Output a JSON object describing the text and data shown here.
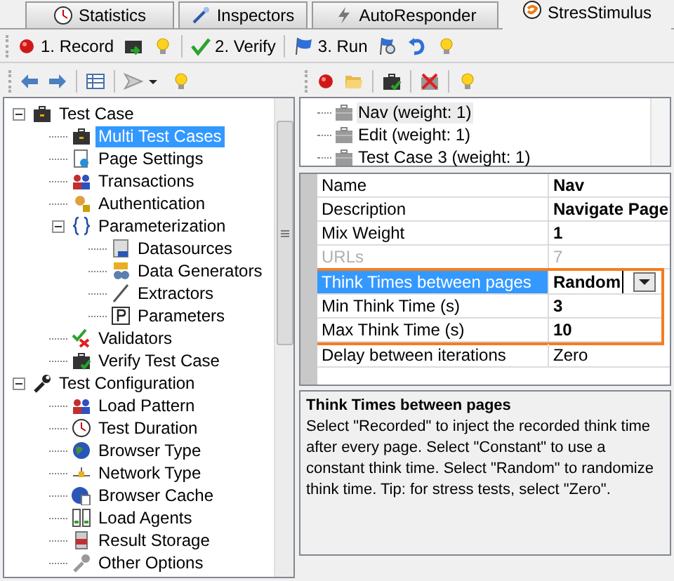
{
  "tabs": [
    {
      "label": "Statistics",
      "selected": false
    },
    {
      "label": "Inspectors",
      "selected": false
    },
    {
      "label": "AutoResponder",
      "selected": false
    },
    {
      "label": "StresStimulus",
      "selected": true
    }
  ],
  "main_toolbar": [
    "1. Record",
    "2. Verify",
    "3. Run"
  ],
  "tree": [
    {
      "label": "Test Case",
      "expanded": true,
      "selected": false,
      "children": [
        {
          "label": "Multi Test Cases",
          "selected": true
        },
        {
          "label": "Page Settings",
          "selected": false
        },
        {
          "label": "Transactions",
          "selected": false
        },
        {
          "label": "Authentication",
          "selected": false
        },
        {
          "label": "Parameterization",
          "expanded": true,
          "selected": false,
          "children": [
            {
              "label": "Datasources",
              "selected": false
            },
            {
              "label": "Data Generators",
              "selected": false
            },
            {
              "label": "Extractors",
              "selected": false
            },
            {
              "label": "Parameters",
              "selected": false
            }
          ]
        },
        {
          "label": "Validators",
          "selected": false
        },
        {
          "label": "Verify Test Case",
          "selected": false
        }
      ]
    },
    {
      "label": "Test Configuration",
      "expanded": true,
      "selected": false,
      "children": [
        {
          "label": "Load Pattern",
          "selected": false
        },
        {
          "label": "Test Duration",
          "selected": false
        },
        {
          "label": "Browser Type",
          "selected": false
        },
        {
          "label": "Network Type",
          "selected": false
        },
        {
          "label": "Browser Cache",
          "selected": false
        },
        {
          "label": "Load Agents",
          "selected": false
        },
        {
          "label": "Result Storage",
          "selected": false
        },
        {
          "label": "Other Options",
          "selected": false
        }
      ]
    }
  ],
  "test_cases": [
    {
      "label": "Nav (weight: 1)",
      "selected": true
    },
    {
      "label": "Edit (weight: 1)",
      "selected": false
    },
    {
      "label": "Test Case 3 (weight: 1)",
      "selected": false
    }
  ],
  "properties": [
    {
      "name": "Name",
      "value": "Nav",
      "modified": true,
      "disabled": false,
      "selected": false,
      "highlighted": false
    },
    {
      "name": "Description",
      "value": "Navigate Page",
      "modified": true,
      "disabled": false,
      "selected": false,
      "highlighted": false
    },
    {
      "name": "Mix Weight",
      "value": "1",
      "modified": true,
      "disabled": false,
      "selected": false,
      "highlighted": false
    },
    {
      "name": "URLs",
      "value": "7",
      "modified": false,
      "disabled": true,
      "selected": false,
      "highlighted": false
    },
    {
      "name": "Think Times between pages",
      "value": "Random",
      "modified": true,
      "disabled": false,
      "selected": true,
      "highlighted": true
    },
    {
      "name": "Min Think Time (s)",
      "value": "3",
      "modified": true,
      "disabled": false,
      "selected": false,
      "highlighted": true
    },
    {
      "name": "Max Think Time (s)",
      "value": "10",
      "modified": true,
      "disabled": false,
      "selected": false,
      "highlighted": true
    },
    {
      "name": "Delay between iterations",
      "value": "Zero",
      "modified": false,
      "disabled": false,
      "selected": false,
      "highlighted": false
    }
  ],
  "help": {
    "title": "Think Times between pages",
    "text": "Select \"Recorded\" to inject the recorded think time after every page. Select \"Constant\" to use a constant think time. Select \"Random\" to randomize think time. Tip: for stress tests, select \"Zero\"."
  }
}
